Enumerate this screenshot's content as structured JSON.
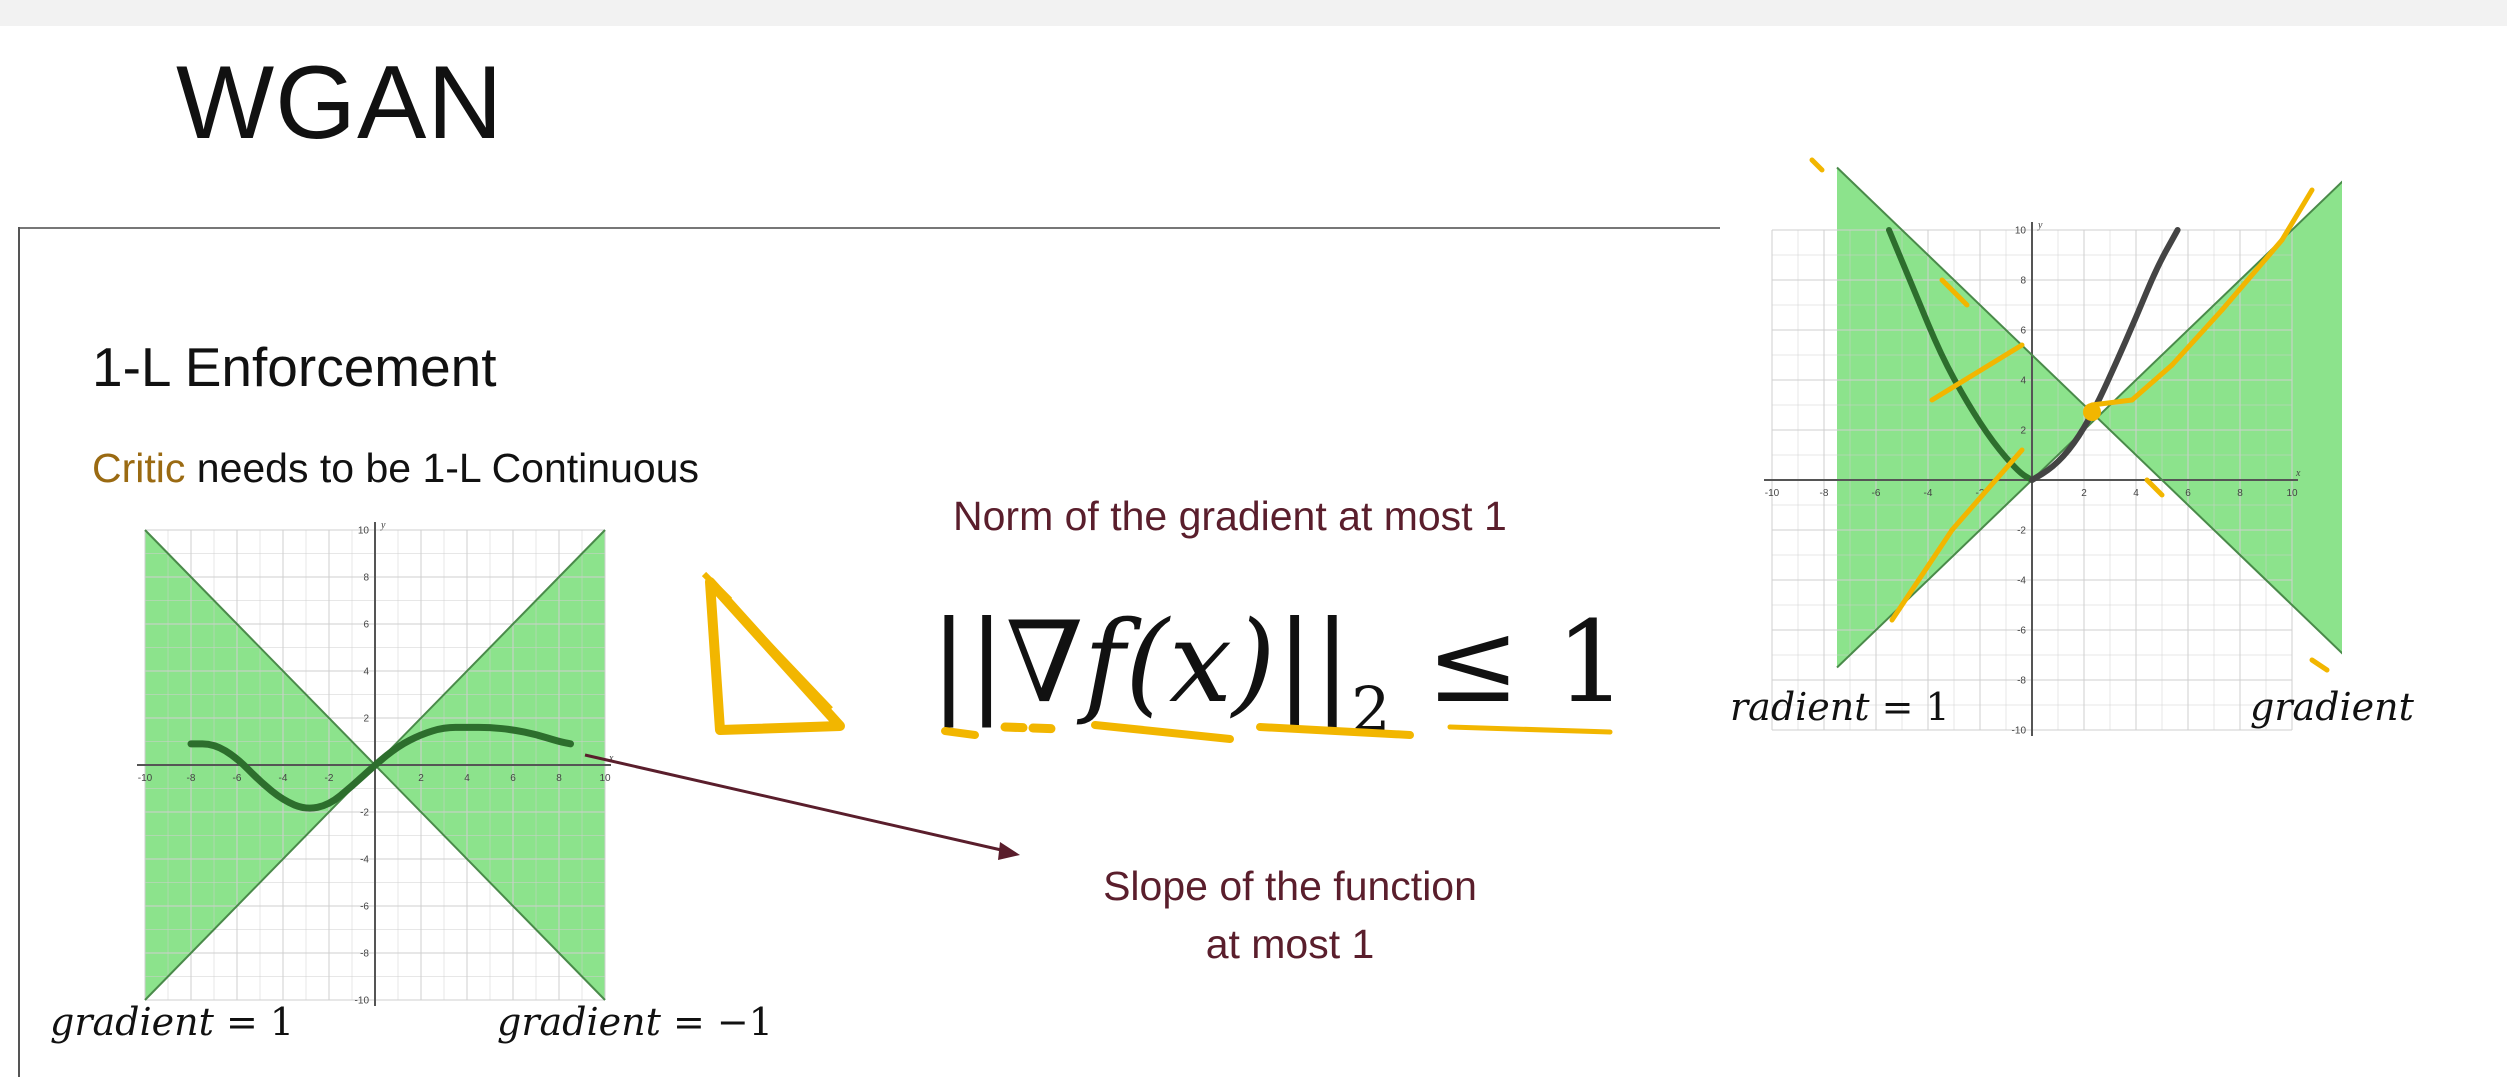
{
  "slide": {
    "title": "WGAN",
    "heading": "1-L Enforcement",
    "subtitle_accent": "Critic",
    "subtitle_rest": " needs to be 1-L Continuous",
    "norm_text": "Norm of the gradient at most 1",
    "slope_line1": "Slope of the function",
    "slope_line2": "at most 1",
    "formula": {
      "left_bars": "||",
      "nabla": "∇",
      "fx": "f(x)",
      "right_bars": "||",
      "subscript": "2",
      "relation": " ≤ 1"
    }
  },
  "labels": {
    "left_gradient_pos": "gradient",
    "left_gradient_pos_val": "= 1",
    "left_gradient_neg": "gradient",
    "left_gradient_neg_val": "= −1",
    "right_gradient_left": "radient",
    "right_gradient_left_val": "= 1",
    "right_gradient_right": "gradient"
  },
  "colors": {
    "cone_fill": "#7fe07f",
    "curve": "#2d6e2d",
    "axis": "#555555",
    "annotation": "#f2b600",
    "arrow": "#5a1e2c",
    "accent": "#9a6a12"
  },
  "chart_data": [
    {
      "type": "line",
      "x_axis_label": "x",
      "y_axis_label": "y",
      "xlim": [
        -10,
        10
      ],
      "ylim": [
        -10,
        10
      ],
      "x_ticks": [
        -10,
        -8,
        -6,
        -4,
        -2,
        2,
        4,
        6,
        8,
        10
      ],
      "y_ticks": [
        10,
        8,
        6,
        4,
        2,
        -2,
        -4,
        -6,
        -8,
        -10
      ],
      "grid": true,
      "series": [
        {
          "x": [
            -8,
            -7,
            -6,
            -5,
            -4,
            -3,
            -2,
            -1,
            0,
            1,
            2,
            3,
            4,
            5,
            6,
            7,
            8,
            8.5
          ],
          "y": [
            0.9,
            0.9,
            0.3,
            -0.7,
            -1.5,
            -1.9,
            -1.7,
            -0.9,
            0,
            0.8,
            1.3,
            1.6,
            1.6,
            1.6,
            1.5,
            1.3,
            1.0,
            0.9
          ]
        }
      ],
      "cone_lines": [
        {
          "x": [
            -10,
            10
          ],
          "y": [
            10,
            -10
          ]
        },
        {
          "x": [
            -10,
            10
          ],
          "y": [
            -10,
            10
          ]
        }
      ]
    },
    {
      "type": "line",
      "x_axis_label": "x",
      "y_axis_label": "y",
      "xlim": [
        -10,
        10
      ],
      "ylim": [
        -10,
        10
      ],
      "x_ticks": [
        -10,
        -8,
        -6,
        -4,
        -2,
        2,
        4,
        6,
        8,
        10
      ],
      "y_ticks": [
        10,
        8,
        6,
        4,
        2,
        -2,
        -4,
        -6,
        -8,
        -10
      ],
      "grid": true,
      "series": [
        {
          "x": [
            -5.5,
            -4.5,
            -3.5,
            -2.5,
            -1.5,
            -0.5,
            0
          ],
          "y": [
            10,
            7.5,
            5.0,
            3.1,
            1.5,
            0.3,
            0
          ]
        },
        {
          "x": [
            0,
            0.8,
            1.6,
            2.4,
            3.2,
            4.0,
            4.8,
            5.6
          ],
          "y": [
            0,
            0.5,
            1.4,
            2.8,
            4.6,
            6.5,
            8.5,
            10
          ]
        }
      ],
      "cone_lines": [
        {
          "x": [
            -7.5,
            12.5
          ],
          "y": [
            12.5,
            -7.5
          ]
        },
        {
          "x": [
            -7.5,
            12.5
          ],
          "y": [
            -7.5,
            12.5
          ]
        }
      ]
    }
  ]
}
